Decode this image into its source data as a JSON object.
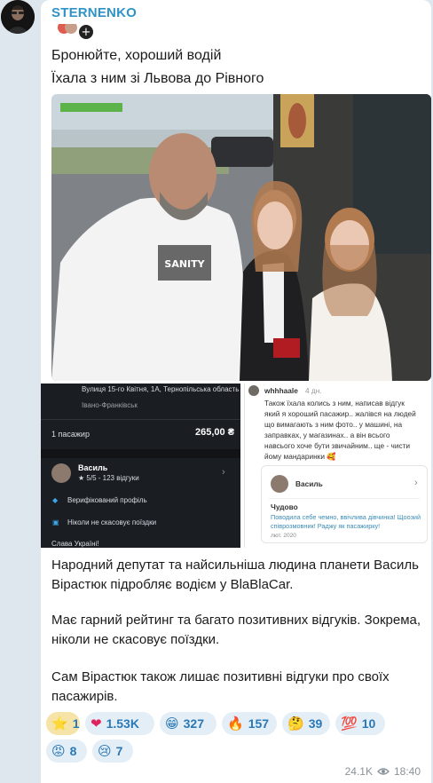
{
  "channel": {
    "name": "STERNENKO",
    "avatar_icon": "person-glasses-avatar"
  },
  "message": {
    "lines": [
      "Бронюйте, хороший водій",
      "Їхала з ним зі Львова до Рівного"
    ],
    "body_lines": [
      "Народний депутат та найсильніша людина планети Василь",
      "Вірастюк підробляє водієм у BlaBlaCar.",
      "",
      "Має гарний рейтинг та багато позитивних відгуків. Зокрема,",
      "ніколи не скасовує поїздки.",
      "",
      "Сам Вірастюк також лишає позитивні відгуки про своїх",
      "пасажирів."
    ]
  },
  "left_screenshot": {
    "address": "Вулиця 15-го Квітня, 1А, Тернопільська область",
    "city": "Івано-Франківськ",
    "passengers_label": "1 пасажир",
    "price": "265,00 ₴",
    "driver_name": "Василь",
    "rating": "★ 5/5 - 123 відгуки",
    "verified": "Верифікований профіль",
    "never_cancels": "Ніколи не скасовує поїздки",
    "glory": "Слава Україні!"
  },
  "right_screenshot": {
    "username": "whhhaale",
    "age": "4 дн.",
    "comment_lines": [
      "Також їхала колись з ним, написав відгук",
      "який я хороший пасажир.. жалівся на людей",
      "що вимагають з ним фото.. у машині, на",
      "заправках, у магазинах.. а він всього",
      "навсього хоче бути звичайним.. ще - чисти",
      "йому мандаринки 🥰"
    ],
    "card_name": "Василь",
    "review_title": "Чудово",
    "review_lines": [
      "Поводила себе чемно, ввічлива дівчинка! Щоозий",
      "співрозмовник! Раджу як пасажирку!"
    ],
    "review_date": "лют. 2020"
  },
  "reactions": [
    {
      "emoji": "⭐",
      "count": "1",
      "active": true
    },
    {
      "emoji": "❤",
      "count": "1.53K"
    },
    {
      "emoji": "😁",
      "count": "327"
    },
    {
      "emoji": "🔥",
      "count": "157"
    },
    {
      "emoji": "🤔",
      "count": "39"
    },
    {
      "emoji": "💯",
      "count": "10"
    },
    {
      "emoji": "😡",
      "count": "8"
    },
    {
      "emoji": "😢",
      "count": "7"
    }
  ],
  "meta": {
    "views": "24.1K",
    "time": "18:40",
    "views_icon": "eye-icon"
  }
}
